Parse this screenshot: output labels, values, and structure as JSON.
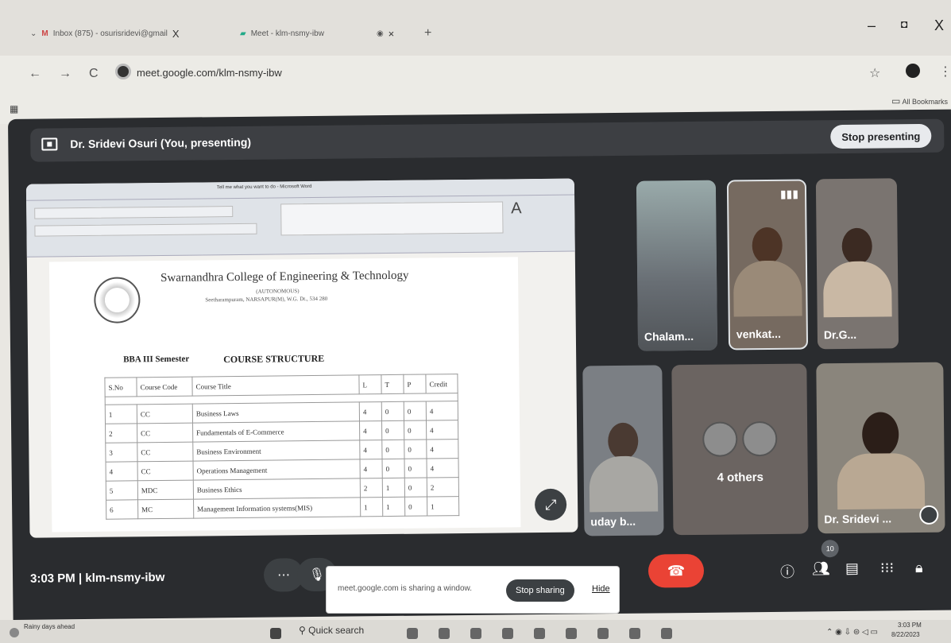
{
  "browser": {
    "tabs": [
      {
        "title": "Inbox (875) - osurisridevi@gmail",
        "close": "X"
      },
      {
        "title": "Meet - klm-nsmy-ibw",
        "close": "×"
      }
    ],
    "new_tab": "+",
    "window_controls": {
      "minimize": "–",
      "maximize": "◘",
      "close": "X"
    },
    "url": "meet.google.com/klm-nsmy-ibw",
    "bookmarks_label": "All Bookmarks",
    "nav": {
      "back": "←",
      "forward": "→",
      "reload": "C"
    }
  },
  "meet": {
    "presenter_bar": "Dr. Sridevi Osuri (You, presenting)",
    "stop_presenting": "Stop presenting",
    "time": "3:03 PM",
    "meeting_code": "klm-nsmy-ibw",
    "participants_count": "10",
    "others_label": "4 others",
    "tiles": [
      {
        "name": "Chalam..."
      },
      {
        "name": "venkat..."
      },
      {
        "name": "Dr.G..."
      },
      {
        "name": "uday b..."
      },
      {
        "name": "Dr. Sridevi ..."
      }
    ]
  },
  "document": {
    "window_title": "Tell me what you want to do - Microsoft Word",
    "college": "Swarnandhra College of Engineering & Technology",
    "autonomous": "(AUTONOMOUS)",
    "address": "Seetharampuram, NARSAPUR(M), W.G. Dt., 534 280",
    "semester": "BBA III Semester",
    "heading": "COURSE STRUCTURE",
    "columns": [
      "S.No",
      "Course Code",
      "Course Title",
      "L",
      "T",
      "P",
      "Credit"
    ],
    "rows": [
      [
        "1",
        "CC",
        "Business Laws",
        "4",
        "0",
        "0",
        "4"
      ],
      [
        "2",
        "CC",
        "Fundamentals of E-Commerce",
        "4",
        "0",
        "0",
        "4"
      ],
      [
        "3",
        "CC",
        "Business Environment",
        "4",
        "0",
        "0",
        "4"
      ],
      [
        "4",
        "CC",
        "Operations Management",
        "4",
        "0",
        "0",
        "4"
      ],
      [
        "5",
        "MDC",
        "Business Ethics",
        "2",
        "1",
        "0",
        "2"
      ],
      [
        "6",
        "MC",
        "Management Information systems(MIS)",
        "1",
        "1",
        "0",
        "1"
      ]
    ]
  },
  "share_popup": {
    "message": "meet.google.com is sharing a window.",
    "stop_button": "Stop sharing",
    "hide_button": "Hide"
  },
  "taskbar": {
    "weather": "Rainy days ahead",
    "search": "Quick search",
    "time": "3:03 PM",
    "date": "8/22/2023"
  }
}
